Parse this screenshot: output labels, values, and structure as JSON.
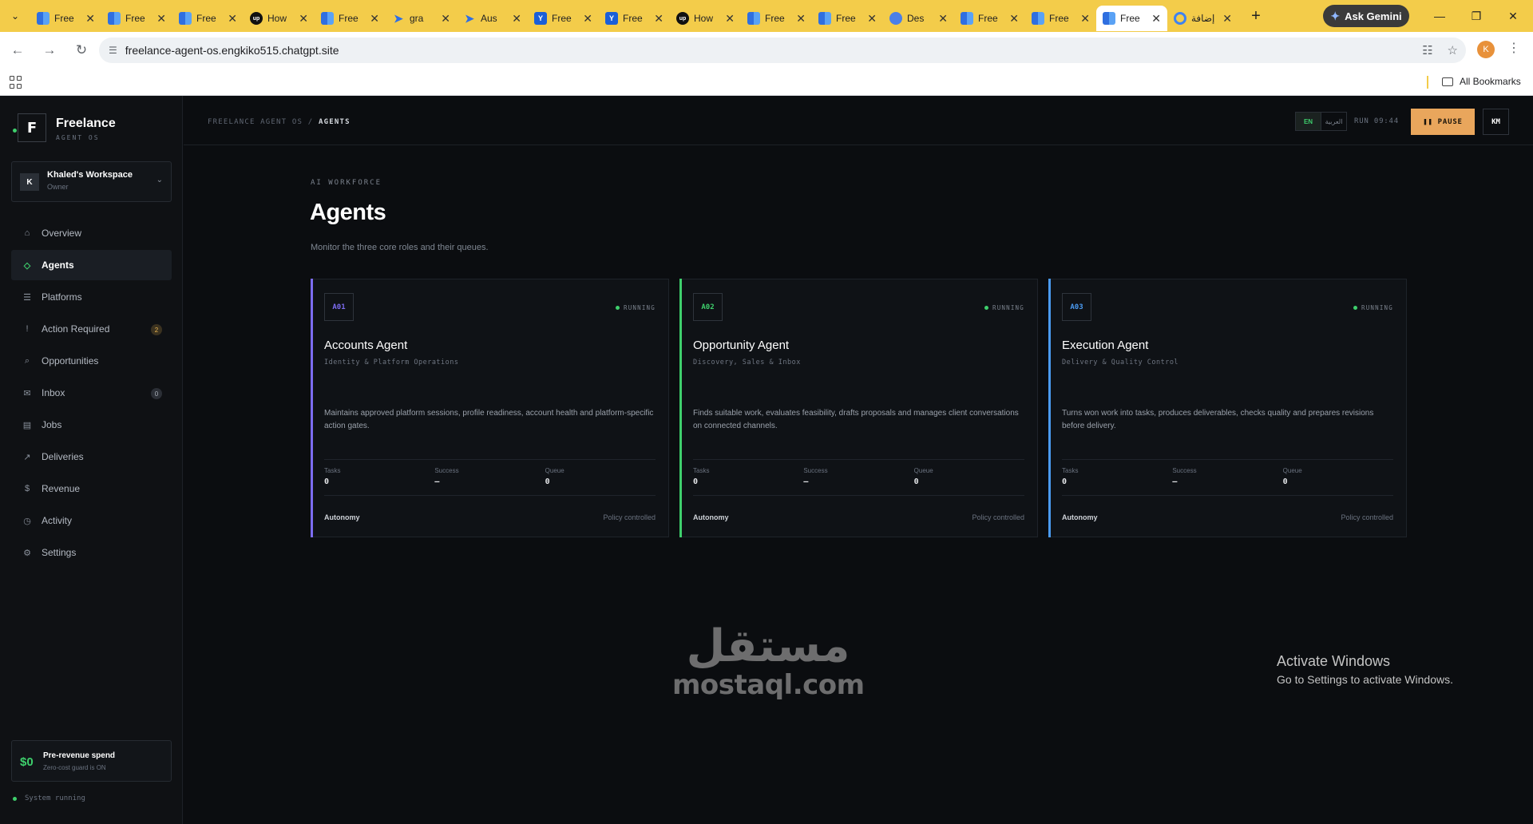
{
  "browser": {
    "tabs": [
      {
        "title": "Free",
        "icon": "grid-icon"
      },
      {
        "title": "Free",
        "icon": "grid-icon"
      },
      {
        "title": "Free",
        "icon": "grid-icon"
      },
      {
        "title": "How",
        "icon": "upwork-icon"
      },
      {
        "title": "Free",
        "icon": "grid-icon"
      },
      {
        "title": "gra",
        "icon": "arrow-icon"
      },
      {
        "title": "Aus",
        "icon": "arrow-icon"
      },
      {
        "title": "Free",
        "icon": "y-icon"
      },
      {
        "title": "Free",
        "icon": "y-icon"
      },
      {
        "title": "How",
        "icon": "upwork-icon"
      },
      {
        "title": "Free",
        "icon": "grid-icon"
      },
      {
        "title": "Free",
        "icon": "grid-icon"
      },
      {
        "title": "Des",
        "icon": "globe-icon"
      },
      {
        "title": "Free",
        "icon": "grid-icon"
      },
      {
        "title": "Free",
        "icon": "grid-icon"
      },
      {
        "title": "Free",
        "icon": "grid-icon"
      },
      {
        "title": "إضافة",
        "icon": "circle-icon"
      }
    ],
    "active_tab_index": 15,
    "ask_gemini": "Ask Gemini",
    "url": "freelance-agent-os.engkiko515.chatgpt.site",
    "all_bookmarks": "All Bookmarks",
    "profile_initial": "K"
  },
  "sidebar": {
    "brand_letter": "F",
    "brand_name": "Freelance",
    "brand_sub": "AGENT OS",
    "workspace": {
      "avatar": "K",
      "name": "Khaled's Workspace",
      "role": "Owner"
    },
    "items": [
      {
        "label": "Overview",
        "icon": "home-icon"
      },
      {
        "label": "Agents",
        "icon": "diamond-icon",
        "active": true
      },
      {
        "label": "Platforms",
        "icon": "list-icon"
      },
      {
        "label": "Action Required",
        "icon": "exclamation-icon",
        "badge": "2"
      },
      {
        "label": "Opportunities",
        "icon": "search-icon"
      },
      {
        "label": "Inbox",
        "icon": "mail-icon",
        "badge": "0"
      },
      {
        "label": "Jobs",
        "icon": "stack-icon"
      },
      {
        "label": "Deliveries",
        "icon": "arrow-out-icon"
      },
      {
        "label": "Revenue",
        "icon": "dollar-icon"
      },
      {
        "label": "Activity",
        "icon": "clock-icon"
      },
      {
        "label": "Settings",
        "icon": "gear-icon"
      }
    ],
    "spend": {
      "amount": "$0",
      "title": "Pre-revenue spend",
      "sub": "Zero-cost guard is ON"
    },
    "system_status": "System running"
  },
  "topbar": {
    "breadcrumb_root": "FREELANCE AGENT OS",
    "breadcrumb_sep": "/",
    "breadcrumb_current": "AGENTS",
    "lang_en": "EN",
    "lang_ar": "العربية",
    "run": "RUN 09:44",
    "pause": "PAUSE",
    "user_initials": "KM"
  },
  "main": {
    "eyebrow": "AI WORKFORCE",
    "title": "Agents",
    "subtitle": "Monitor the three core roles and their queues.",
    "stat_labels": {
      "tasks": "Tasks",
      "success": "Success",
      "queue": "Queue"
    },
    "autonomy_label": "Autonomy",
    "agents": [
      {
        "code": "A01",
        "status": "RUNNING",
        "name": "Accounts Agent",
        "role": "Identity & Platform Operations",
        "description": "Maintains approved platform sessions, profile readiness, account health and platform-specific action gates.",
        "tasks": "0",
        "success": "—",
        "queue": "0",
        "autonomy": "Policy controlled",
        "accent": "#7c6cf0"
      },
      {
        "code": "A02",
        "status": "RUNNING",
        "name": "Opportunity Agent",
        "role": "Discovery, Sales & Inbox",
        "description": "Finds suitable work, evaluates feasibility, drafts proposals and manages client conversations on connected channels.",
        "tasks": "0",
        "success": "—",
        "queue": "0",
        "autonomy": "Policy controlled",
        "accent": "#3ecf6c"
      },
      {
        "code": "A03",
        "status": "RUNNING",
        "name": "Execution Agent",
        "role": "Delivery & Quality Control",
        "description": "Turns won work into tasks, produces deliverables, checks quality and prepares revisions before delivery.",
        "tasks": "0",
        "success": "—",
        "queue": "0",
        "autonomy": "Policy controlled",
        "accent": "#4a9af0"
      }
    ]
  },
  "watermark": {
    "arabic": "مستقل",
    "latin": "mostaql.com"
  },
  "windows_activation": {
    "line1": "Activate Windows",
    "line2": "Go to Settings to activate Windows."
  }
}
